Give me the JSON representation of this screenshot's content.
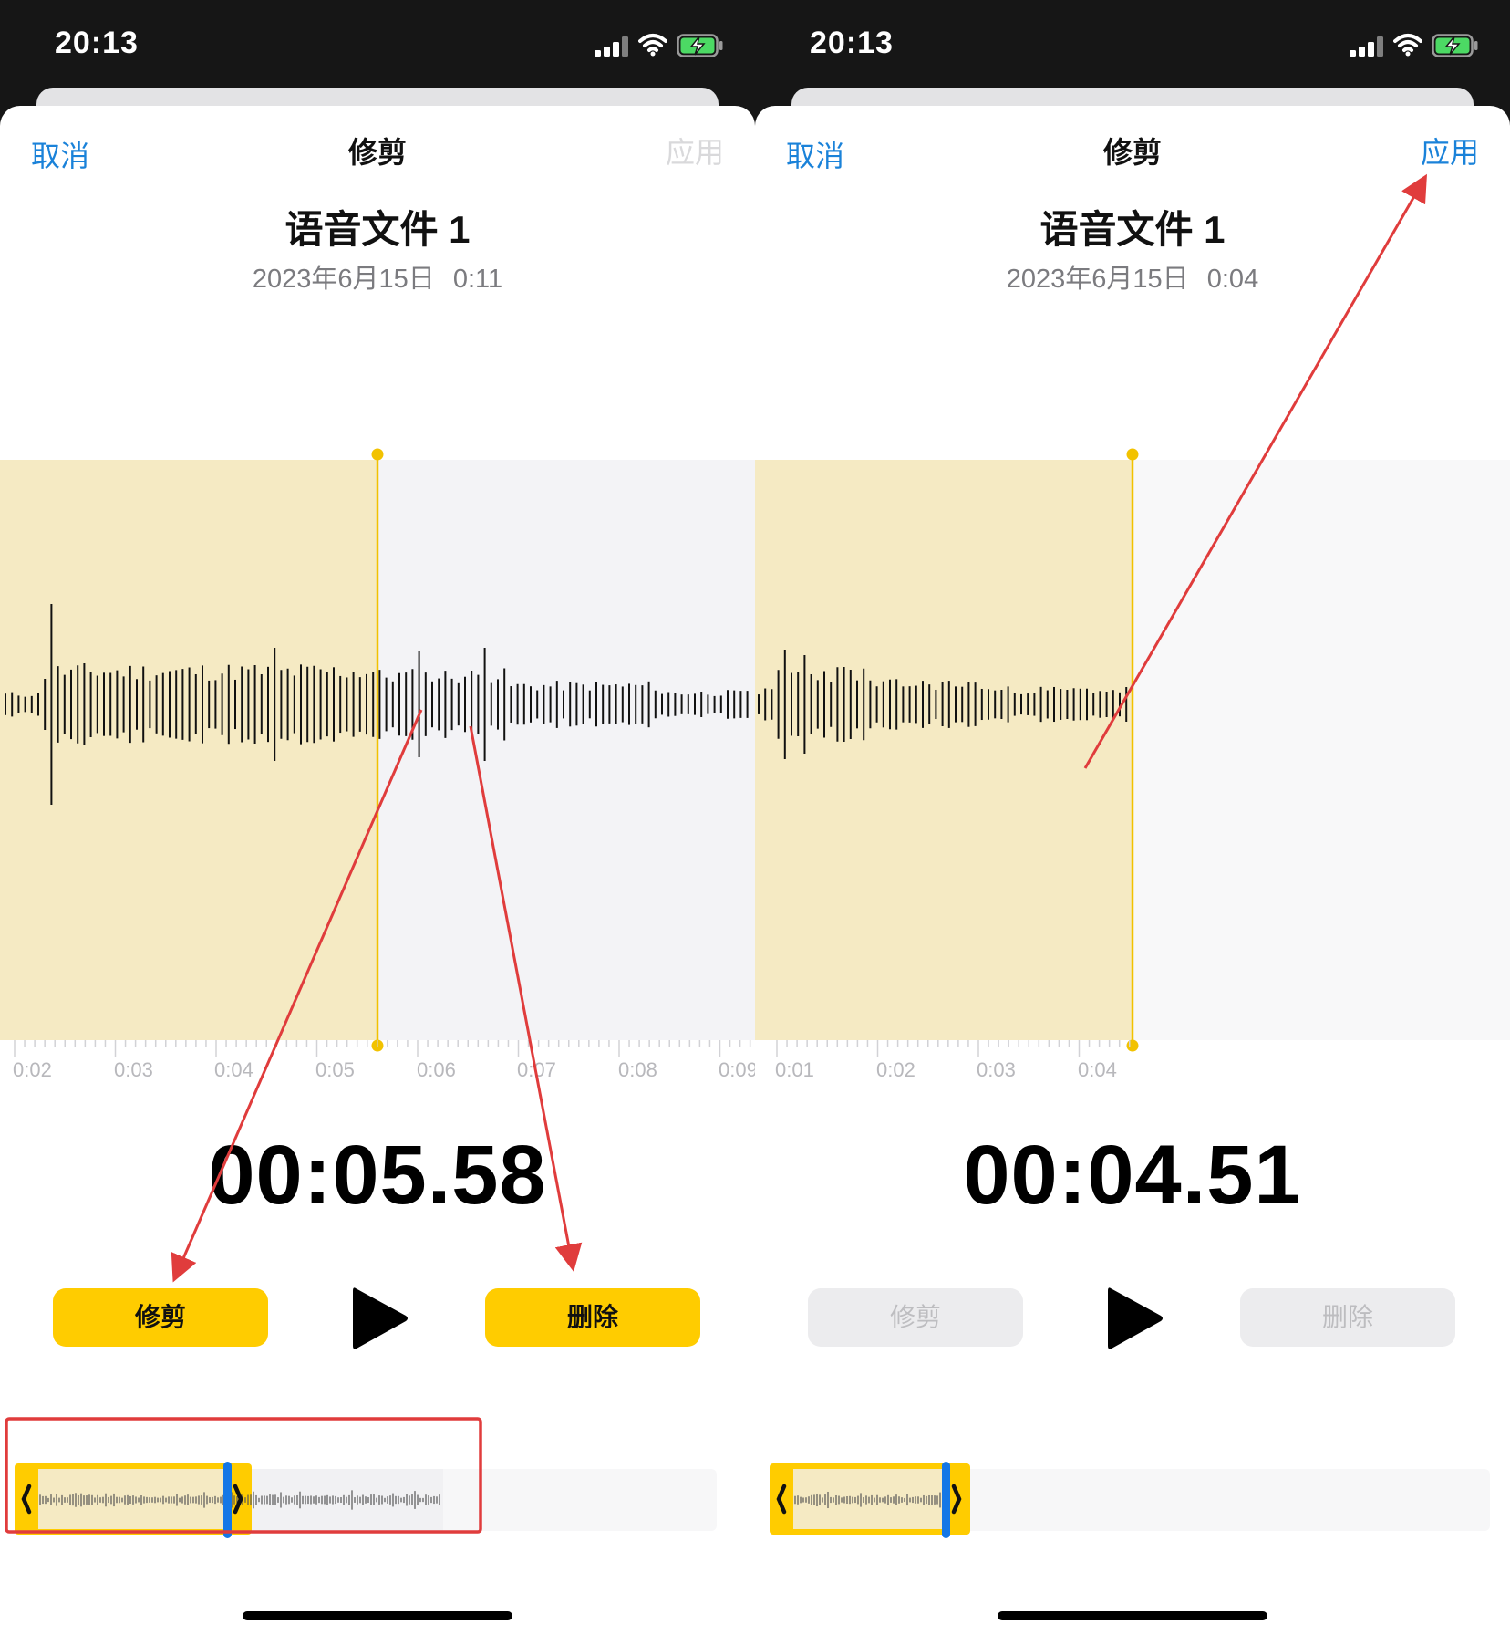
{
  "screens": [
    {
      "status_time": "20:13",
      "nav": {
        "cancel": "取消",
        "title": "修剪",
        "apply": "应用",
        "apply_enabled": false
      },
      "recording": {
        "name": "语音文件 1",
        "date": "2023年6月15日",
        "duration": "0:11"
      },
      "timeline_ticks": [
        "0:02",
        "0:03",
        "0:04",
        "0:05",
        "0:06",
        "0:07",
        "0:08",
        "0:09"
      ],
      "timecode": "00:05.58",
      "buttons": {
        "trim": "修剪",
        "delete": "删除",
        "enabled": true
      },
      "selection_fraction": 0.5
    },
    {
      "status_time": "20:13",
      "nav": {
        "cancel": "取消",
        "title": "修剪",
        "apply": "应用",
        "apply_enabled": true
      },
      "recording": {
        "name": "语音文件 1",
        "date": "2023年6月15日",
        "duration": "0:04"
      },
      "timeline_ticks": [
        "0:01",
        "0:02",
        "0:03",
        "0:04"
      ],
      "timecode": "00:04.51",
      "buttons": {
        "trim": "修剪",
        "delete": "删除",
        "enabled": false
      },
      "selection_fraction": 0.5
    }
  ],
  "colors": {
    "accent_blue": "#1a82d9",
    "selection_yellow": "#ffcc00",
    "selected_region": "#f5eac3",
    "unselected_region": "#f3f3f6",
    "annotation_red": "#e03c3c",
    "playhead_blue": "#1477e6"
  },
  "icons": [
    "cellular-signal-icon",
    "wifi-icon",
    "battery-charging-icon",
    "play-icon"
  ]
}
